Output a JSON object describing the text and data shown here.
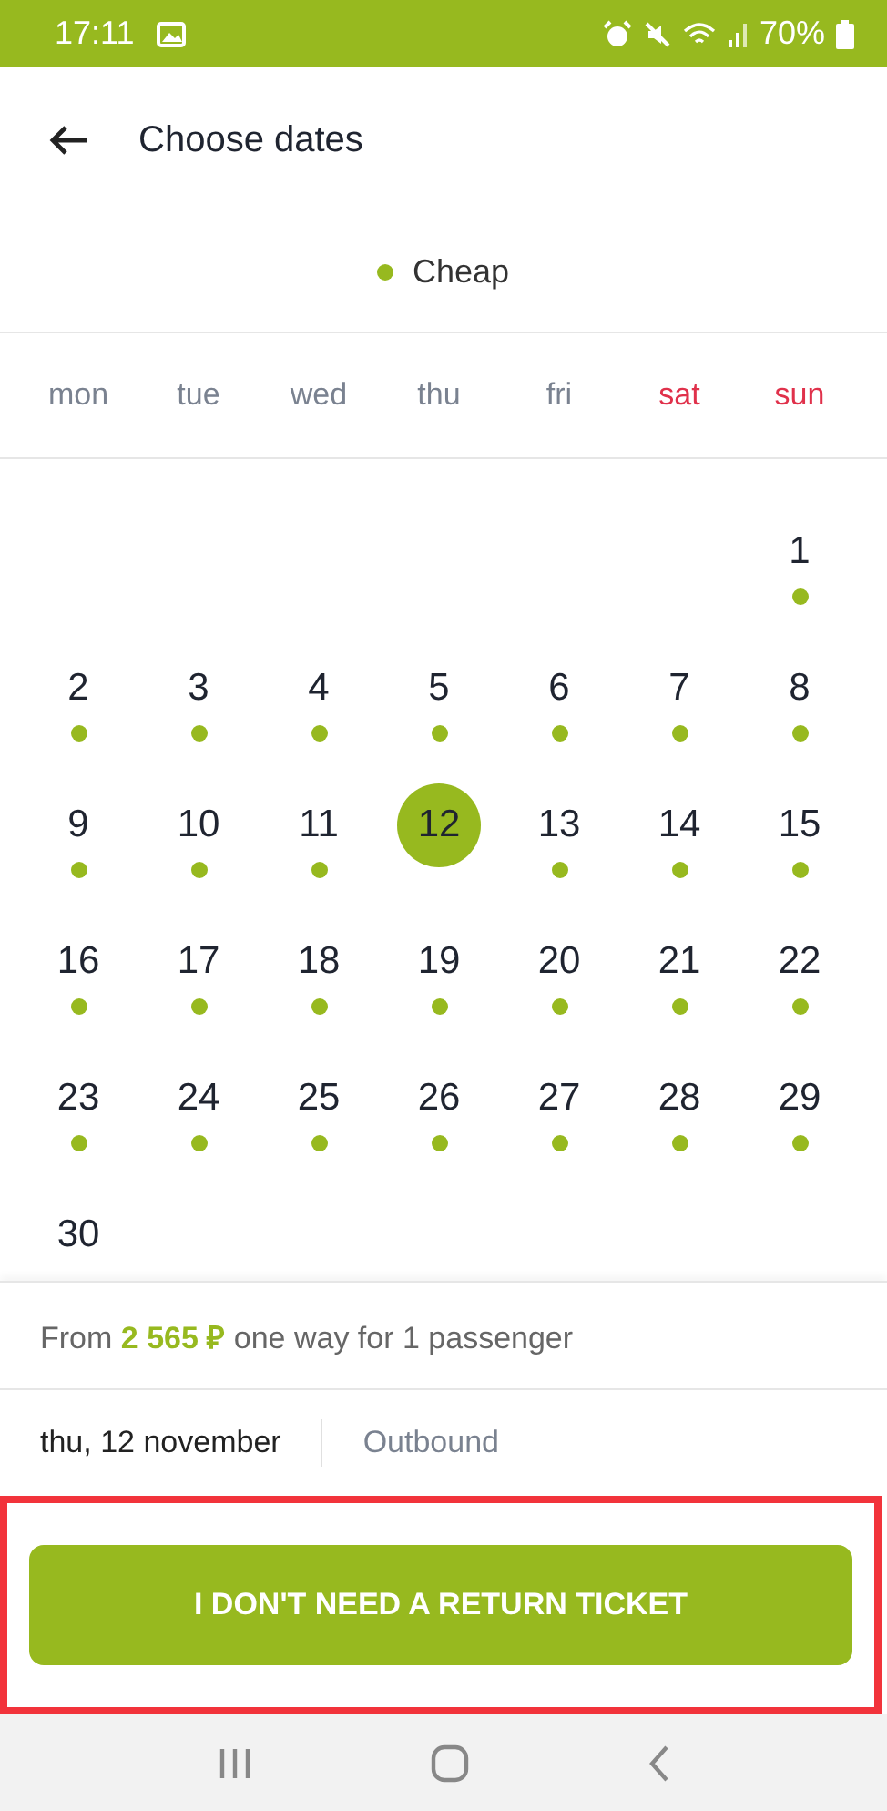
{
  "status_bar": {
    "time": "17:11",
    "battery": "70%"
  },
  "header": {
    "title": "Choose dates"
  },
  "legend": {
    "label": "Cheap",
    "color": "#97b91f"
  },
  "weekdays": [
    {
      "label": "mon",
      "weekend": false
    },
    {
      "label": "tue",
      "weekend": false
    },
    {
      "label": "wed",
      "weekend": false
    },
    {
      "label": "thu",
      "weekend": false
    },
    {
      "label": "fri",
      "weekend": false
    },
    {
      "label": "sat",
      "weekend": true
    },
    {
      "label": "sun",
      "weekend": true
    }
  ],
  "days": [
    {
      "day": "1",
      "cheap": true,
      "selected": false
    },
    {
      "day": "2",
      "cheap": true,
      "selected": false
    },
    {
      "day": "3",
      "cheap": true,
      "selected": false
    },
    {
      "day": "4",
      "cheap": true,
      "selected": false
    },
    {
      "day": "5",
      "cheap": true,
      "selected": false
    },
    {
      "day": "6",
      "cheap": true,
      "selected": false
    },
    {
      "day": "7",
      "cheap": true,
      "selected": false
    },
    {
      "day": "8",
      "cheap": true,
      "selected": false
    },
    {
      "day": "9",
      "cheap": true,
      "selected": false
    },
    {
      "day": "10",
      "cheap": true,
      "selected": false
    },
    {
      "day": "11",
      "cheap": true,
      "selected": false
    },
    {
      "day": "12",
      "cheap": false,
      "selected": true
    },
    {
      "day": "13",
      "cheap": true,
      "selected": false
    },
    {
      "day": "14",
      "cheap": true,
      "selected": false
    },
    {
      "day": "15",
      "cheap": true,
      "selected": false
    },
    {
      "day": "16",
      "cheap": true,
      "selected": false
    },
    {
      "day": "17",
      "cheap": true,
      "selected": false
    },
    {
      "day": "18",
      "cheap": true,
      "selected": false
    },
    {
      "day": "19",
      "cheap": true,
      "selected": false
    },
    {
      "day": "20",
      "cheap": true,
      "selected": false
    },
    {
      "day": "21",
      "cheap": true,
      "selected": false
    },
    {
      "day": "22",
      "cheap": true,
      "selected": false
    },
    {
      "day": "23",
      "cheap": true,
      "selected": false
    },
    {
      "day": "24",
      "cheap": true,
      "selected": false
    },
    {
      "day": "25",
      "cheap": true,
      "selected": false
    },
    {
      "day": "26",
      "cheap": true,
      "selected": false
    },
    {
      "day": "27",
      "cheap": true,
      "selected": false
    },
    {
      "day": "28",
      "cheap": true,
      "selected": false
    },
    {
      "day": "29",
      "cheap": true,
      "selected": false
    },
    {
      "day": "30",
      "cheap": false,
      "selected": false
    }
  ],
  "price_note": "From **2 565 ₽** one way for 1 passenger",
  "selection": {
    "date": "thu, 12 november",
    "leg": "Outbound"
  },
  "action": {
    "label": "I DON'T NEED A RETURN TICKET",
    "highlighted": true
  }
}
